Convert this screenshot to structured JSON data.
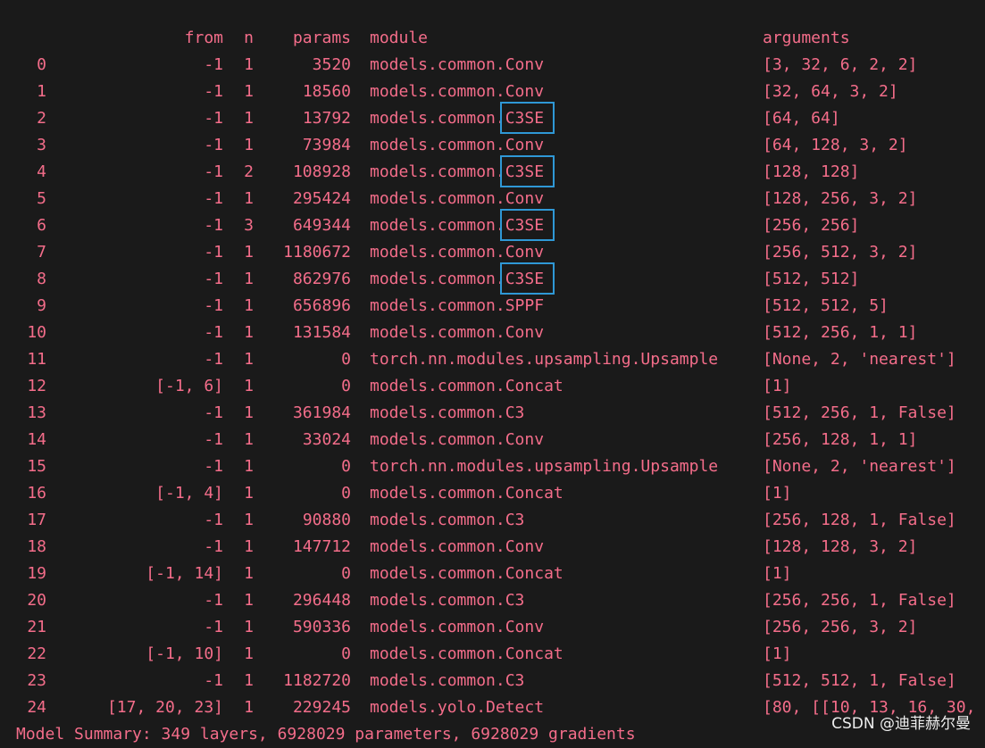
{
  "header": {
    "from": "from",
    "n": "n",
    "params": "params",
    "module": "module",
    "arguments": "arguments"
  },
  "rows": [
    {
      "idx": "0",
      "from": "-1",
      "n": "1",
      "params": "3520",
      "module": "models.common.Conv",
      "args": "[3, 32, 6, 2, 2]"
    },
    {
      "idx": "1",
      "from": "-1",
      "n": "1",
      "params": "18560",
      "module": "models.common.Conv",
      "args": "[32, 64, 3, 2]"
    },
    {
      "idx": "2",
      "from": "-1",
      "n": "1",
      "params": "13792",
      "module": "models.common.C3SE",
      "args": "[64, 64]",
      "highlight": true
    },
    {
      "idx": "3",
      "from": "-1",
      "n": "1",
      "params": "73984",
      "module": "models.common.Conv",
      "args": "[64, 128, 3, 2]"
    },
    {
      "idx": "4",
      "from": "-1",
      "n": "2",
      "params": "108928",
      "module": "models.common.C3SE",
      "args": "[128, 128]",
      "highlight": true
    },
    {
      "idx": "5",
      "from": "-1",
      "n": "1",
      "params": "295424",
      "module": "models.common.Conv",
      "args": "[128, 256, 3, 2]"
    },
    {
      "idx": "6",
      "from": "-1",
      "n": "3",
      "params": "649344",
      "module": "models.common.C3SE",
      "args": "[256, 256]",
      "highlight": true
    },
    {
      "idx": "7",
      "from": "-1",
      "n": "1",
      "params": "1180672",
      "module": "models.common.Conv",
      "args": "[256, 512, 3, 2]"
    },
    {
      "idx": "8",
      "from": "-1",
      "n": "1",
      "params": "862976",
      "module": "models.common.C3SE",
      "args": "[512, 512]",
      "highlight": true
    },
    {
      "idx": "9",
      "from": "-1",
      "n": "1",
      "params": "656896",
      "module": "models.common.SPPF",
      "args": "[512, 512, 5]"
    },
    {
      "idx": "10",
      "from": "-1",
      "n": "1",
      "params": "131584",
      "module": "models.common.Conv",
      "args": "[512, 256, 1, 1]"
    },
    {
      "idx": "11",
      "from": "-1",
      "n": "1",
      "params": "0",
      "module": "torch.nn.modules.upsampling.Upsample",
      "args": "[None, 2, 'nearest']"
    },
    {
      "idx": "12",
      "from": "[-1, 6]",
      "n": "1",
      "params": "0",
      "module": "models.common.Concat",
      "args": "[1]"
    },
    {
      "idx": "13",
      "from": "-1",
      "n": "1",
      "params": "361984",
      "module": "models.common.C3",
      "args": "[512, 256, 1, False]"
    },
    {
      "idx": "14",
      "from": "-1",
      "n": "1",
      "params": "33024",
      "module": "models.common.Conv",
      "args": "[256, 128, 1, 1]"
    },
    {
      "idx": "15",
      "from": "-1",
      "n": "1",
      "params": "0",
      "module": "torch.nn.modules.upsampling.Upsample",
      "args": "[None, 2, 'nearest']"
    },
    {
      "idx": "16",
      "from": "[-1, 4]",
      "n": "1",
      "params": "0",
      "module": "models.common.Concat",
      "args": "[1]"
    },
    {
      "idx": "17",
      "from": "-1",
      "n": "1",
      "params": "90880",
      "module": "models.common.C3",
      "args": "[256, 128, 1, False]"
    },
    {
      "idx": "18",
      "from": "-1",
      "n": "1",
      "params": "147712",
      "module": "models.common.Conv",
      "args": "[128, 128, 3, 2]"
    },
    {
      "idx": "19",
      "from": "[-1, 14]",
      "n": "1",
      "params": "0",
      "module": "models.common.Concat",
      "args": "[1]"
    },
    {
      "idx": "20",
      "from": "-1",
      "n": "1",
      "params": "296448",
      "module": "models.common.C3",
      "args": "[256, 256, 1, False]"
    },
    {
      "idx": "21",
      "from": "-1",
      "n": "1",
      "params": "590336",
      "module": "models.common.Conv",
      "args": "[256, 256, 3, 2]"
    },
    {
      "idx": "22",
      "from": "[-1, 10]",
      "n": "1",
      "params": "0",
      "module": "models.common.Concat",
      "args": "[1]"
    },
    {
      "idx": "23",
      "from": "-1",
      "n": "1",
      "params": "1182720",
      "module": "models.common.C3",
      "args": "[512, 512, 1, False]"
    },
    {
      "idx": "24",
      "from": "[17, 20, 23]",
      "n": "1",
      "params": "229245",
      "module": "models.yolo.Detect",
      "args": "[80, [[10, 13, 16, 30,"
    }
  ],
  "summary": "Model Summary: 349 layers, 6928029 parameters, 6928029 gradients",
  "watermark": "CSDN @迪菲赫尔曼",
  "colors": {
    "background": "#1a1a1a",
    "text": "#f46d8a",
    "highlight_box": "#2f98d6",
    "watermark": "#ffffff"
  }
}
